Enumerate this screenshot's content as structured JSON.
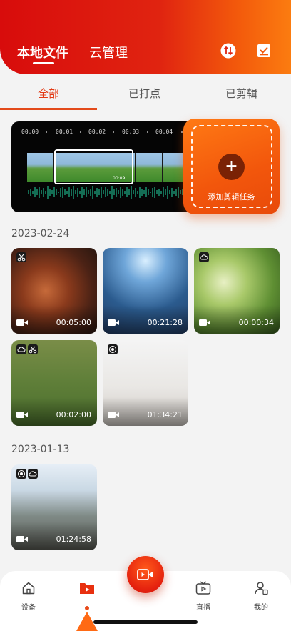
{
  "header": {
    "tabs": [
      {
        "label": "本地文件",
        "active": true
      },
      {
        "label": "云管理",
        "active": false
      }
    ],
    "icons": [
      "sort-icon",
      "checklist-icon"
    ],
    "colors": {
      "start": "#d80c0c",
      "end": "#fb7c10"
    }
  },
  "filter_tabs": [
    {
      "label": "全部",
      "active": true
    },
    {
      "label": "已打点",
      "active": false
    },
    {
      "label": "已剪辑",
      "active": false
    }
  ],
  "editor": {
    "timeline_labels": [
      "00:00",
      "00:01",
      "00:02",
      "00:03",
      "00:04"
    ],
    "selection_time": "00:09",
    "add_task_label": "添加剪辑任务",
    "add_icon": "plus-icon"
  },
  "groups": [
    {
      "date": "2023-02-24",
      "videos": [
        {
          "duration": "00:05:00",
          "scene": "basketball",
          "badges": [
            "scissors-icon"
          ]
        },
        {
          "duration": "00:21:28",
          "scene": "ice-hockey",
          "badges": []
        },
        {
          "duration": "00:00:34",
          "scene": "badminton",
          "badges": [
            "cloud-icon"
          ]
        },
        {
          "duration": "00:02:00",
          "scene": "soccer",
          "badges": [
            "cloud-icon",
            "scissors-icon"
          ]
        },
        {
          "duration": "01:34:21",
          "scene": "yoga",
          "badges": [
            "target-icon"
          ]
        }
      ]
    },
    {
      "date": "2023-01-13",
      "videos": [
        {
          "duration": "01:24:58",
          "scene": "basketball-outdoor",
          "badges": [
            "target-icon",
            "cloud-icon"
          ]
        }
      ]
    }
  ],
  "bottom_nav": [
    {
      "label": "设备",
      "icon": "home-icon"
    },
    {
      "label": "",
      "icon": "folder-play-icon",
      "active": true
    },
    {
      "label": "",
      "icon": "record-video-icon"
    },
    {
      "label": "直播",
      "icon": "tv-icon"
    },
    {
      "label": "我的",
      "icon": "profile-icon"
    }
  ],
  "accent_color": "#e84a1a"
}
